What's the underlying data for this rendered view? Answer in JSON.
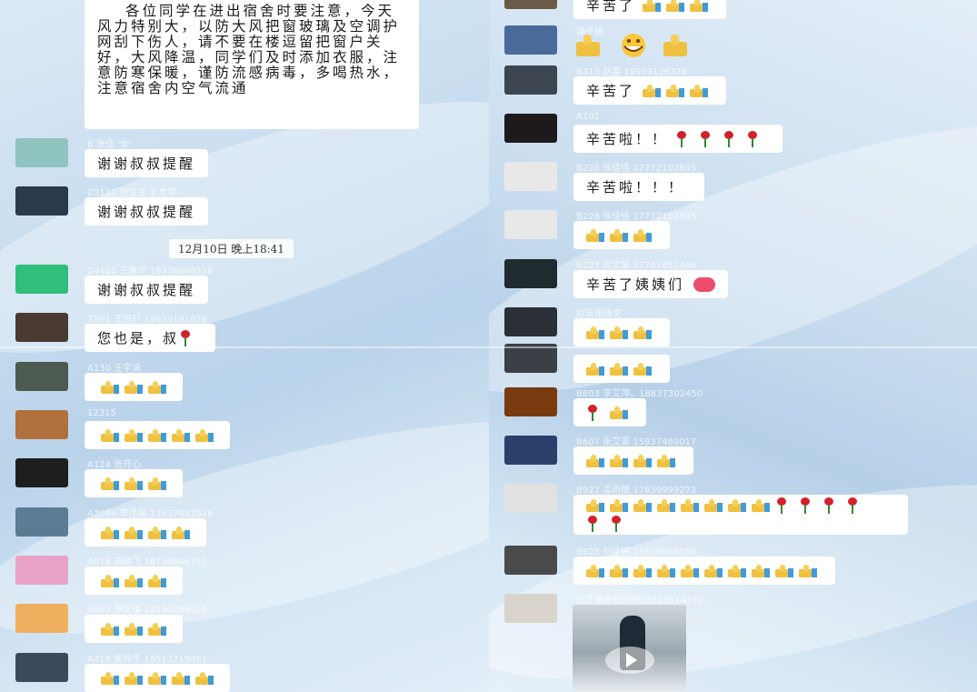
{
  "notice": {
    "text": "各位同学在进出宿舍时要注意，今天风力特别大，以防大风把窗玻璃及空调护网刮下伤人，请不要在楼逗留把窗户关好，大风降温，同学们及时添加衣服，注意防寒保暖，谨防流感病毒，多喝热水，注意宿舍内空气流通"
  },
  "left_messages": [
    {
      "name": "B 张佳 \"B\"",
      "text": "谢谢叔叔提醒",
      "avatar_color": "#8fc4c0"
    },
    {
      "name": "Z3112 张立主 2 文字",
      "text": "谢谢叔叔提醒",
      "avatar_color": "#2b3a4a"
    },
    {
      "name": "Z4132 王雅宁 18336808218",
      "text": "谢谢叔叔提醒",
      "avatar_color": "#2fbf7a"
    },
    {
      "name": "Z501 王悦轩 19639161878",
      "text": "您也是，叔",
      "avatar_color": "#4a3b32"
    },
    {
      "name": "A130 王宇涵",
      "thumbs": 3,
      "avatar_color": "#4d5a52"
    },
    {
      "name": "12315",
      "thumbs": 5,
      "avatar_color": "#b0713f"
    },
    {
      "name": "A124 张开心",
      "thumbs": 3,
      "avatar_color": "#1e1e1e"
    },
    {
      "name": "A2094 李佳易 13537682576",
      "thumbs": 4,
      "avatar_color": "#5b7c93"
    },
    {
      "name": "A618 高晓飞 18739846711",
      "thumbs": 3,
      "avatar_color": "#e6a3c5"
    },
    {
      "name": "A463 罗文瑾 18790484015",
      "thumbs": 3,
      "avatar_color": "#f0b060"
    },
    {
      "name": "A416 崔梓宁 19513219461",
      "thumbs": 5,
      "avatar_color": "#3a4a5c"
    }
  ],
  "timestamp": "12月10日 晚上18:41",
  "right_messages": [
    {
      "name": "",
      "text": "辛苦了",
      "thumbs": 3,
      "avatar_color": "#6b5a48"
    },
    {
      "name": "静子妍",
      "big_emoji": true,
      "avatar_color": "#4a6a9a"
    },
    {
      "name": "B313 赵嘉 19939136376",
      "text": "辛苦了",
      "thumbs": 3,
      "avatar_color": "#3c4650"
    },
    {
      "name": "A101",
      "text": "辛苦啦！！",
      "roses": 4,
      "avatar_color": "#1e1a1c"
    },
    {
      "name": "B228 徐佳佳 17772102895",
      "text": "辛苦啦！！！",
      "avatar_color": "#e8e8e8"
    },
    {
      "name": "B228 徐佳佳 17772102895",
      "thumbs": 3,
      "avatar_color": "#e8e8e8"
    },
    {
      "name": "B227 刘文星 17761652460",
      "text": "辛苦了姨姨们",
      "heart": true,
      "avatar_color": "#1f2b2e"
    },
    {
      "name": "赵宏张佳文",
      "thumbs": 3,
      "avatar_color": "#2a2f38"
    },
    {
      "name": "",
      "thumbs": 3,
      "avatar_color": "#3a3f48"
    },
    {
      "name": "B603 李艾萍。18837302450",
      "roses": 1,
      "thumbs": 1,
      "avatar_color": "#7a3a10"
    },
    {
      "name": "B607 张艾姿 15937469017",
      "thumbs": 4,
      "avatar_color": "#2b3f6b"
    },
    {
      "name": "B927 孟雨婕 17639999273",
      "thumbs": 8,
      "roses": 4,
      "roses_line2": 2,
      "avatar_color": "#e2e2e2"
    },
    {
      "name": "B925 刘佳婷 15638608558",
      "thumbs": 10,
      "avatar_color": "#4a4a4a"
    },
    {
      "name": "北艾楼宿管阿姨13613914749",
      "video": true,
      "avatar_color": "#d8d4cc"
    }
  ]
}
